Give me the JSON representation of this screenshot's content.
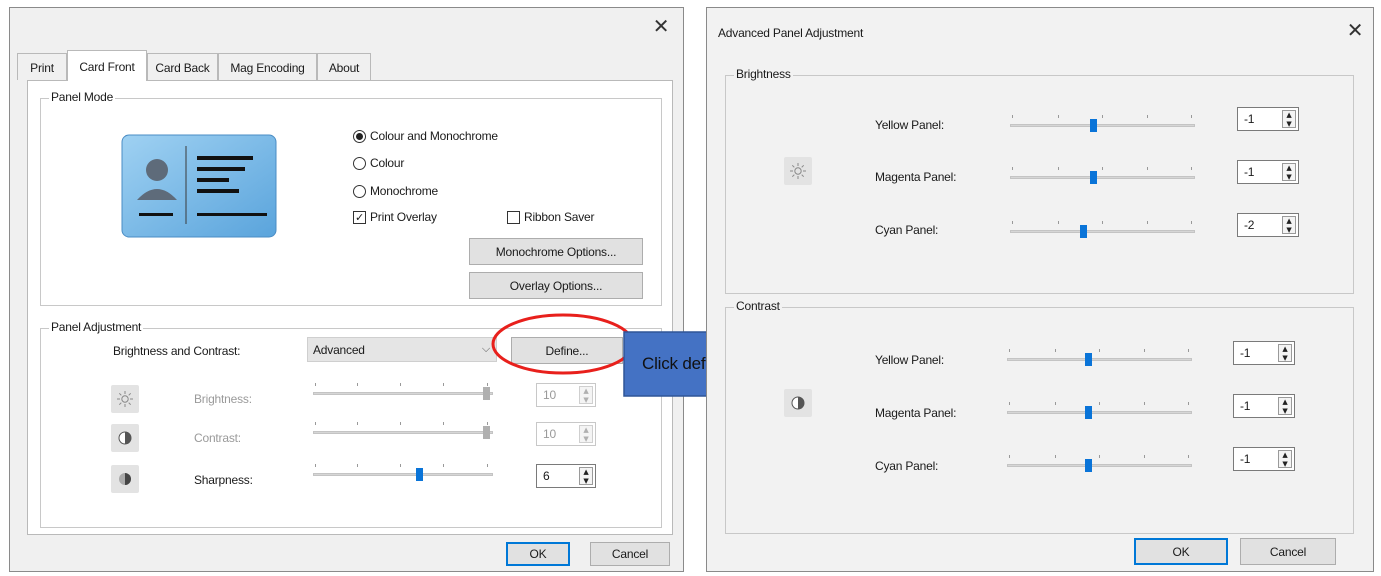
{
  "left_dialog": {
    "close_symbol": "✕",
    "tabs": [
      {
        "label": "Print"
      },
      {
        "label": "Card Front"
      },
      {
        "label": "Card Back"
      },
      {
        "label": "Mag Encoding"
      },
      {
        "label": "About"
      }
    ],
    "active_tab": "Card Front",
    "panel_mode": {
      "title": "Panel Mode",
      "radio_colour_mono": "Colour and Monochrome",
      "radio_colour": "Colour",
      "radio_mono": "Monochrome",
      "selected": "Colour and Monochrome",
      "print_overlay_label": "Print Overlay",
      "print_overlay_checked": true,
      "ribbon_saver_label": "Ribbon Saver",
      "ribbon_saver_checked": false,
      "mono_options_button": "Monochrome Options...",
      "overlay_options_button": "Overlay Options..."
    },
    "panel_adjustment": {
      "title": "Panel Adjustment",
      "bc_label": "Brightness and Contrast:",
      "bc_value": "Advanced",
      "define_button": "Define...",
      "brightness_label": "Brightness:",
      "brightness_value": "10",
      "contrast_label": "Contrast:",
      "contrast_value": "10",
      "sharpness_label": "Sharpness:",
      "sharpness_value": "6"
    },
    "ok_button": "OK",
    "cancel_button": "Cancel"
  },
  "callout": {
    "text": "Click define",
    "arrow_color": "#4472c4",
    "highlight_color": "#e8201c"
  },
  "right_dialog": {
    "title": "Advanced Panel Adjustment",
    "close_symbol": "✕",
    "brightness": {
      "title": "Brightness",
      "yellow_label": "Yellow Panel:",
      "yellow_value": "-1",
      "magenta_label": "Magenta Panel:",
      "magenta_value": "-1",
      "cyan_label": "Cyan Panel:",
      "cyan_value": "-2"
    },
    "contrast": {
      "title": "Contrast",
      "yellow_label": "Yellow Panel:",
      "yellow_value": "-1",
      "magenta_label": "Magenta Panel:",
      "magenta_value": "-1",
      "cyan_label": "Cyan Panel:",
      "cyan_value": "-1"
    },
    "ok_button": "OK",
    "cancel_button": "Cancel"
  }
}
